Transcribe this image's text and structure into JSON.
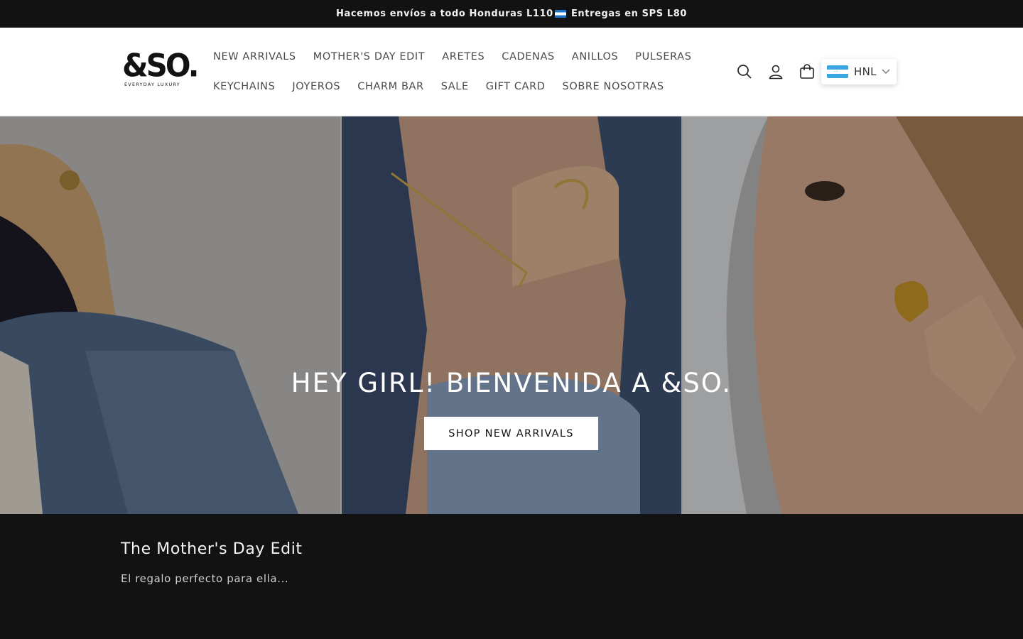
{
  "announcement": {
    "text_before": "Hacemos envíos a todo Honduras L110",
    "text_after": " Entregas en SPS L80"
  },
  "logo": {
    "main": "&SO.",
    "tagline": "EVERYDAY LUXURY"
  },
  "nav": {
    "row1": [
      "NEW ARRIVALS",
      "MOTHER'S DAY EDIT",
      "ARETES",
      "CADENAS",
      "ANILLOS",
      "PULSERAS"
    ],
    "row2": [
      "KEYCHAINS",
      "JOYEROS",
      "CHARM BAR",
      "SALE",
      "GIFT CARD",
      "SOBRE NOSOTRAS"
    ]
  },
  "header_icons": [
    "search-icon",
    "account-icon",
    "cart-icon"
  ],
  "currency": {
    "code": "HNL",
    "flag": "honduras-flag"
  },
  "hero": {
    "title": "HEY GIRL! BIENVENIDA A &SO.",
    "button": "SHOP NEW ARRIVALS"
  },
  "feature": {
    "title": "The Mother's Day Edit",
    "subtitle": "El regalo perfecto para ella..."
  },
  "colors": {
    "dark": "#121212",
    "white": "#ffffff",
    "nav_text": "#4a4a4a",
    "flag_blue": "#3aa7e0"
  }
}
